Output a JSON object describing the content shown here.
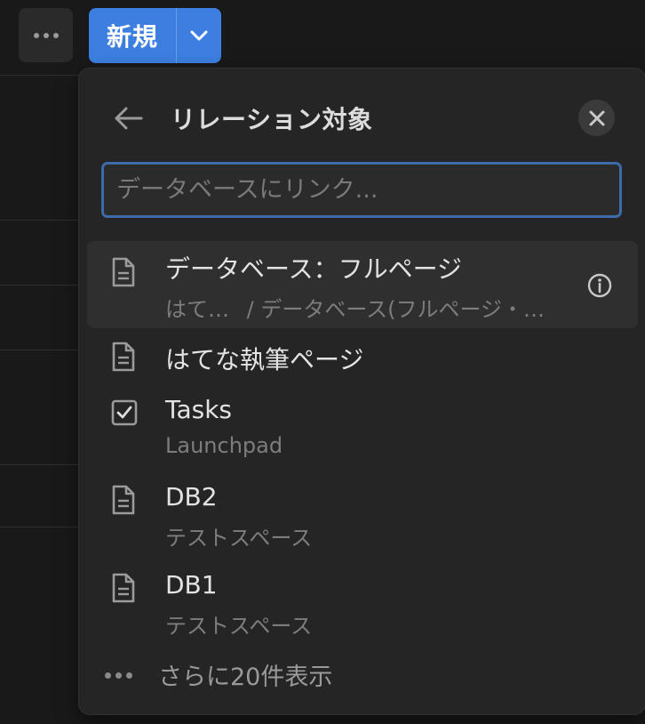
{
  "toolbar": {
    "more_icon": "more-horizontal-icon",
    "new_label": "新規",
    "new_dropdown_icon": "chevron-down-icon",
    "accent_color": "#3c7fe0"
  },
  "panel": {
    "title": "リレーション対象",
    "back_icon": "arrow-left-icon",
    "close_icon": "close-icon",
    "search_placeholder": "データベースにリンク...",
    "items": [
      {
        "icon": "page-icon",
        "title": "データベース：フルページ",
        "subtitle_prefix": "はて…",
        "subtitle_path": "/ データベース(フルページ・…",
        "info_icon": "info-icon"
      },
      {
        "icon": "page-icon",
        "title": "はてな執筆ページ"
      },
      {
        "icon": "checkbox-icon",
        "title": "Tasks",
        "subtitle": "Launchpad"
      },
      {
        "icon": "page-icon",
        "title": "DB2",
        "subtitle": "テストスペース"
      },
      {
        "icon": "page-icon",
        "title": "DB1",
        "subtitle": "テストスペース"
      }
    ],
    "show_more": "さらに20件表示"
  }
}
